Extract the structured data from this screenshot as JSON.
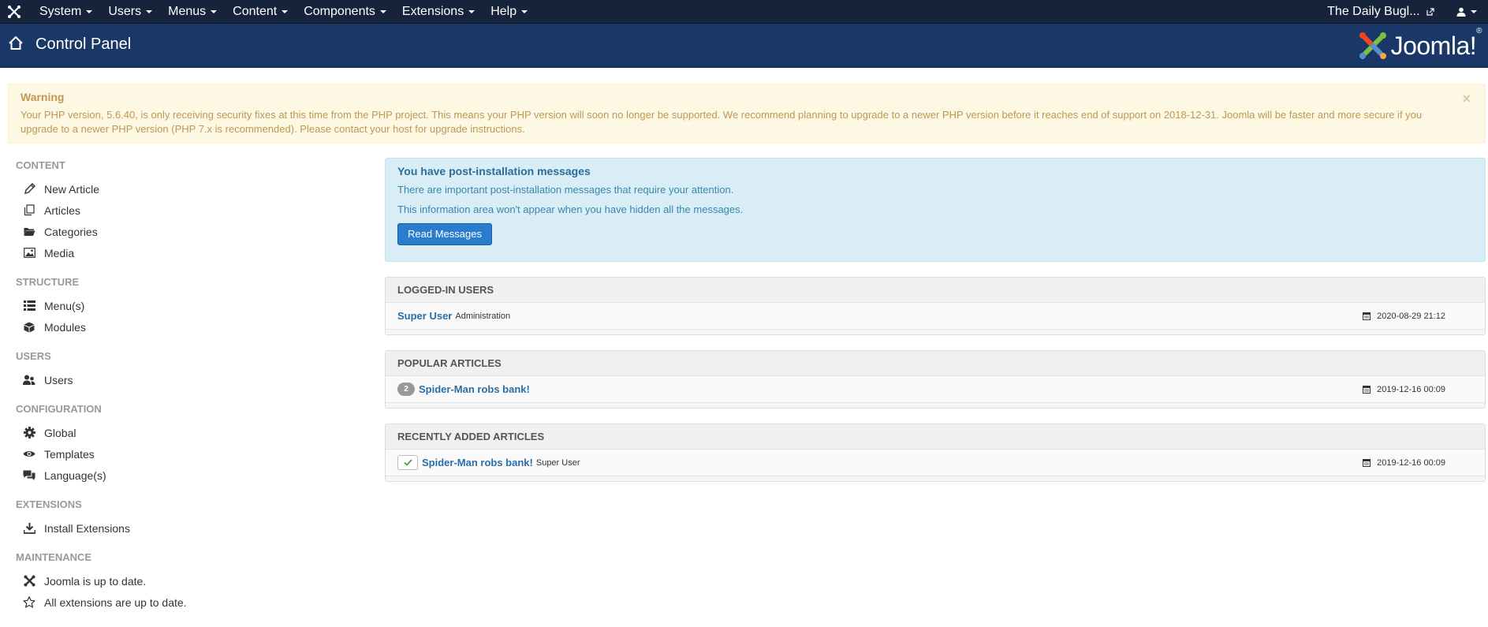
{
  "navbar": {
    "logo_icon": "joomla-logo-icon",
    "menu": [
      {
        "label": "System"
      },
      {
        "label": "Users"
      },
      {
        "label": "Menus"
      },
      {
        "label": "Content"
      },
      {
        "label": "Components"
      },
      {
        "label": "Extensions"
      },
      {
        "label": "Help"
      }
    ],
    "site_link": "The Daily Bugl...",
    "user_icon": "user-icon"
  },
  "header": {
    "title": "Control Panel",
    "brand": "Joomla!",
    "brand_mark": "®"
  },
  "alert": {
    "heading": "Warning",
    "text": "Your PHP version, 5.6.40, is only receiving security fixes at this time from the PHP project. This means your PHP version will soon no longer be supported. We recommend planning to upgrade to a newer PHP version before it reaches end of support on 2018-12-31. Joomla will be faster and more secure if you upgrade to a newer PHP version (PHP 7.x is recommended). Please contact your host for upgrade instructions.",
    "close": "×"
  },
  "sidebar": {
    "groups": [
      {
        "header": "CONTENT",
        "items": [
          {
            "label": "New Article",
            "icon": "pencil-icon"
          },
          {
            "label": "Articles",
            "icon": "stack-icon"
          },
          {
            "label": "Categories",
            "icon": "folder-icon"
          },
          {
            "label": "Media",
            "icon": "image-icon"
          }
        ]
      },
      {
        "header": "STRUCTURE",
        "items": [
          {
            "label": "Menu(s)",
            "icon": "list-icon"
          },
          {
            "label": "Modules",
            "icon": "cube-icon"
          }
        ]
      },
      {
        "header": "USERS",
        "items": [
          {
            "label": "Users",
            "icon": "users-icon"
          }
        ]
      },
      {
        "header": "CONFIGURATION",
        "items": [
          {
            "label": "Global",
            "icon": "gear-icon"
          },
          {
            "label": "Templates",
            "icon": "eye-icon"
          },
          {
            "label": "Language(s)",
            "icon": "comments-icon"
          }
        ]
      },
      {
        "header": "EXTENSIONS",
        "items": [
          {
            "label": "Install Extensions",
            "icon": "download-icon"
          }
        ]
      },
      {
        "header": "MAINTENANCE",
        "items": [
          {
            "label": "Joomla is up to date.",
            "icon": "joomla-icon"
          },
          {
            "label": "All extensions are up to date.",
            "icon": "star-icon"
          }
        ]
      }
    ]
  },
  "postinstall": {
    "title": "You have post-installation messages",
    "line1": "There are important post-installation messages that require your attention.",
    "line2": "This information area won't appear when you have hidden all the messages.",
    "button": "Read Messages"
  },
  "modules": {
    "logged_in": {
      "title": "LOGGED-IN USERS",
      "user": "Super User",
      "role": "Administration",
      "date": "2020-08-29 21:12"
    },
    "popular": {
      "title": "POPULAR ARTICLES",
      "hits": "2",
      "article": "Spider-Man robs bank!",
      "date": "2019-12-16 00:09"
    },
    "recent": {
      "title": "RECENTLY ADDED ARTICLES",
      "article": "Spider-Man robs bank!",
      "author": "Super User",
      "date": "2019-12-16 00:09"
    }
  }
}
